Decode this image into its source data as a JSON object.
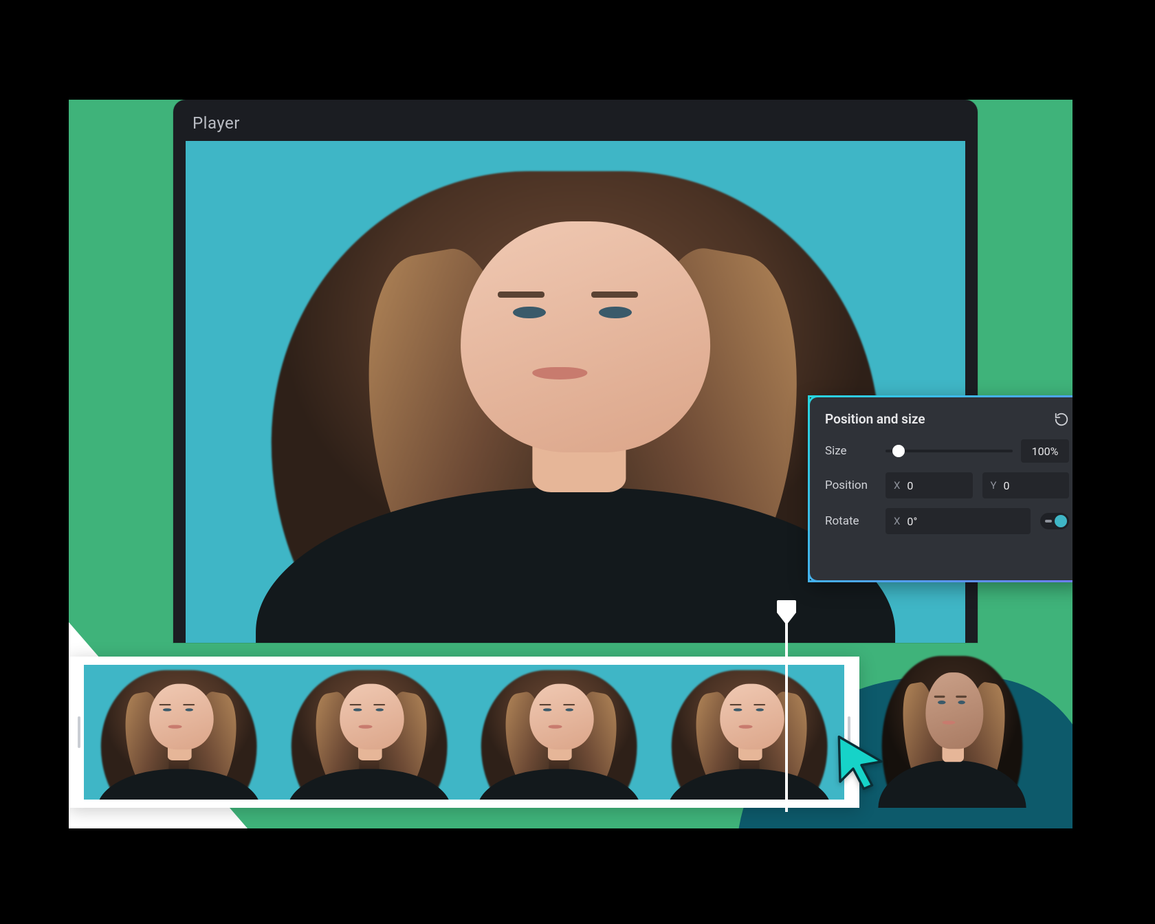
{
  "player": {
    "title": "Player"
  },
  "panel": {
    "title": "Position and size",
    "size_label": "Size",
    "size_value": "100%",
    "position_label": "Position",
    "position_x_axis": "X",
    "position_x_value": "0",
    "position_y_axis": "Y",
    "position_y_value": "0",
    "rotate_label": "Rotate",
    "rotate_x_axis": "X",
    "rotate_x_value": "0°"
  },
  "icons": {
    "reset": "reset-icon",
    "playhead": "playhead-marker",
    "cursor": "cursor-pointer"
  },
  "timeline": {
    "frame_count": 4
  }
}
